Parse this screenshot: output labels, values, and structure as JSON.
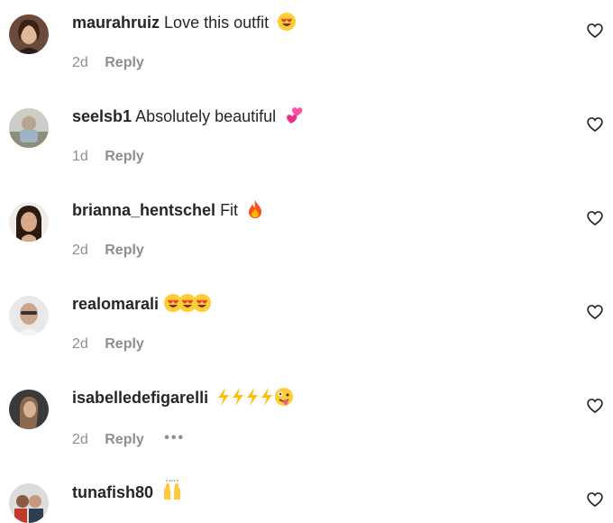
{
  "comments": [
    {
      "username": "maurahruiz",
      "text": "Love this outfit",
      "emoji": [
        "heart-eyes"
      ],
      "time": "2d",
      "reply_label": "Reply"
    },
    {
      "username": "seelsb1",
      "text": "Absolutely beautiful",
      "emoji": [
        "two-hearts"
      ],
      "time": "1d",
      "reply_label": "Reply"
    },
    {
      "username": "brianna_hentschel",
      "text": "Fit",
      "emoji": [
        "fire"
      ],
      "time": "2d",
      "reply_label": "Reply"
    },
    {
      "username": "realomarali",
      "text": "",
      "emoji": [
        "heart-eyes",
        "heart-eyes",
        "heart-eyes"
      ],
      "time": "2d",
      "reply_label": "Reply"
    },
    {
      "username": "isabelledefigarelli",
      "text": "",
      "emoji": [
        "lightning",
        "lightning",
        "lightning",
        "lightning",
        "zany-face"
      ],
      "time": "2d",
      "reply_label": "Reply",
      "more_label": "•••"
    },
    {
      "username": "tunafish80",
      "text": "",
      "emoji": [
        "raising-hands"
      ]
    }
  ],
  "colors": {
    "username": "#262626",
    "meta": "#8e8e8e",
    "heart_outline": "#262626"
  }
}
